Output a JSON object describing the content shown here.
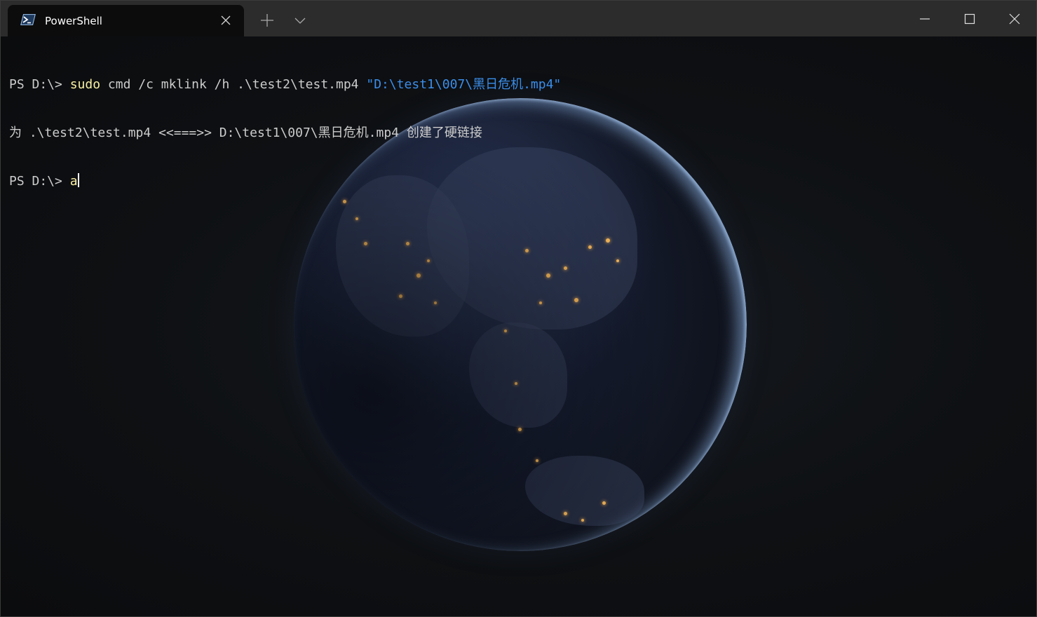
{
  "window": {
    "tab_title": "PowerShell",
    "icons": {
      "tab": "powershell-icon",
      "tab_close": "close-icon",
      "new_tab": "plus-icon",
      "dropdown": "chevron-down-icon",
      "minimize": "minimize-icon",
      "maximize": "maximize-icon",
      "close": "close-icon"
    }
  },
  "terminal": {
    "lines": [
      {
        "prompt": "PS D:\\> ",
        "command": "sudo",
        "args": " cmd /c mklink /h .\\test2\\test.mp4 ",
        "string_arg": "\"D:\\test1\\007\\黑日危机.mp4\""
      },
      {
        "output": "为 .\\test2\\test.mp4 <<===>> D:\\test1\\007\\黑日危机.mp4 创建了硬链接"
      },
      {
        "prompt": "PS D:\\> ",
        "input": "a"
      }
    ],
    "colors": {
      "foreground": "#cccccc",
      "command": "#f9f1a5",
      "string": "#3b8eea",
      "background": "#0c0d10"
    }
  }
}
